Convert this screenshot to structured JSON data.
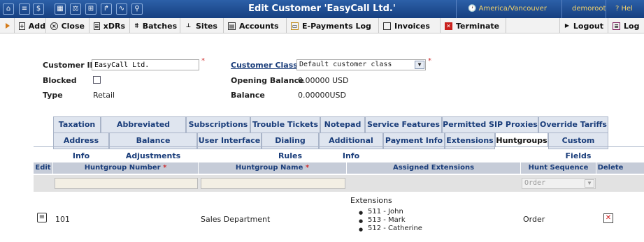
{
  "window": {
    "title": "Edit Customer 'EasyCall Ltd.'",
    "timezone": "America/Vancouver",
    "user": "demoroot",
    "help": "Hel"
  },
  "toolbar": {
    "add": "Add",
    "close": "Close",
    "xdrs": "xDRs",
    "batches": "Batches",
    "sites": "Sites",
    "accounts": "Accounts",
    "epayments": "E-Payments Log",
    "invoices": "Invoices",
    "terminate": "Terminate",
    "logout": "Logout",
    "log": "Log"
  },
  "form": {
    "customer_id_label": "Customer ID",
    "customer_id_value": "EasyCall Ltd.",
    "blocked_label": "Blocked",
    "type_label": "Type",
    "type_value": "Retail",
    "customer_class_label": "Customer Class",
    "customer_class_value": "Default customer class",
    "opening_balance_label": "Opening Balance",
    "opening_balance_value": "0.00000 USD",
    "balance_label": "Balance",
    "balance_value": "0.00000USD"
  },
  "tabs": {
    "row1": [
      "Taxation",
      "Abbreviated Dialing",
      "Subscriptions",
      "Trouble Tickets",
      "Notepad",
      "Service Features",
      "Permitted SIP Proxies",
      "Override Tariffs"
    ],
    "row2": [
      "Address Info",
      "Balance Adjustments",
      "User Interface",
      "Dialing Rules",
      "Additional Info",
      "Payment Info",
      "Extensions",
      "Huntgroups",
      "Custom Fields"
    ]
  },
  "table": {
    "headers": {
      "edit": "Edit",
      "number": "Huntgroup Number",
      "name": "Huntgroup Name",
      "assigned": "Assigned Extensions",
      "sequence": "Hunt Sequence",
      "delete": "Delete"
    },
    "filter_sequence": "Order",
    "rows": [
      {
        "number": "101",
        "name": "Sales Department",
        "extensions_label": "Extensions",
        "extensions": [
          "511 - John",
          "513 - Mark",
          "512 - Catherine"
        ],
        "sequence": "Order"
      }
    ]
  }
}
